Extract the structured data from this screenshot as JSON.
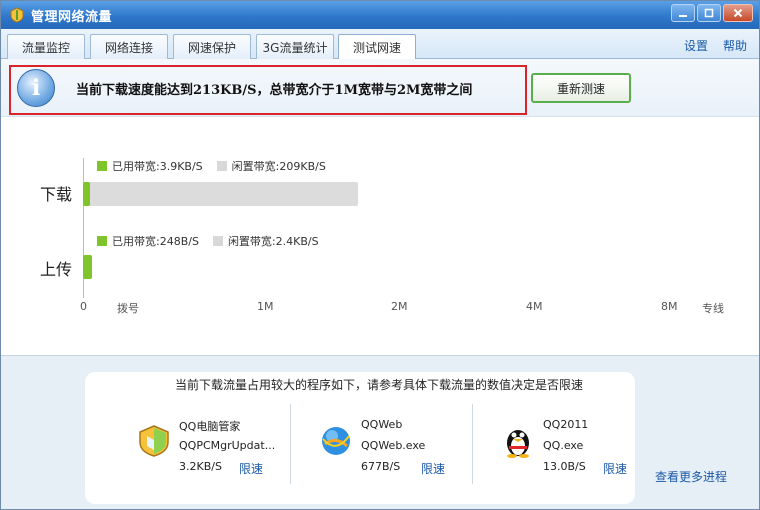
{
  "window": {
    "title": "管理网络流量",
    "minimize": "–",
    "maximize": "□",
    "close": "✕"
  },
  "tabs": [
    {
      "label": "流量监控"
    },
    {
      "label": "网络连接"
    },
    {
      "label": "网速保护"
    },
    {
      "label": "3G流量统计"
    },
    {
      "label": "测试网速",
      "active": true
    }
  ],
  "top_links": {
    "settings": "设置",
    "help": "帮助"
  },
  "banner": {
    "message": "当前下载速度能达到213KB/S，总带宽介于1M宽带与2M宽带之间",
    "retest_label": "重新测速",
    "icon": "info-icon"
  },
  "chart_data": {
    "type": "bar",
    "orientation": "horizontal",
    "categories": [
      "下载",
      "上传"
    ],
    "series": [
      {
        "name": "已用带宽",
        "values_text": [
          "3.9KB/S",
          "248B/S"
        ],
        "color": "#7fc42a"
      },
      {
        "name": "闲置带宽",
        "values_text": [
          "209KB/S",
          "2.4KB/S"
        ],
        "color": "#dcdcdc"
      }
    ],
    "download": {
      "used_label": "已用带宽:3.9KB/S",
      "idle_label": "闲置带宽:209KB/S",
      "total_mbps": 1.7,
      "used_mbps": 0.03
    },
    "upload": {
      "used_label": "已用带宽:248B/S",
      "idle_label": "闲置带宽:2.4KB/S",
      "total_mbps": 0.05,
      "used_mbps": 0.05
    },
    "x_ticks": [
      "0",
      "拨号",
      "1M",
      "2M",
      "4M",
      "8M",
      "专线"
    ],
    "xlim_labels": [
      "0",
      "专线"
    ]
  },
  "bottom": {
    "title": "当前下载流量占用较大的程序如下，请参考具体下载流量的数值决定是否限速",
    "processes": [
      {
        "name": "QQ电脑管家",
        "exe": "QQPCMgrUpdat...",
        "speed": "3.2KB/S",
        "limit": "限速",
        "icon": "shield-icon"
      },
      {
        "name": "QQWeb",
        "exe": "QQWeb.exe",
        "speed": "677B/S",
        "limit": "限速",
        "icon": "globe-icon"
      },
      {
        "name": "QQ2011",
        "exe": "QQ.exe",
        "speed": "13.0B/S",
        "limit": "限速",
        "icon": "penguin-icon"
      }
    ],
    "more_link": "查看更多进程"
  }
}
